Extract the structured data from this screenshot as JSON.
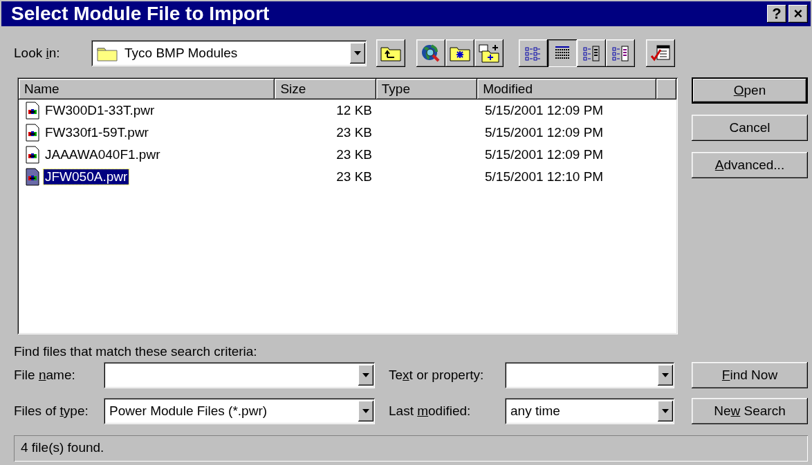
{
  "window": {
    "title": "Select Module File to Import",
    "help_button": "?",
    "close_button": "×"
  },
  "look_in": {
    "label": {
      "before": "Look ",
      "key": "i",
      "after": "n:"
    },
    "value": "Tyco BMP Modules"
  },
  "view_buttons": [
    {
      "selected": false
    },
    {
      "selected": true
    },
    {
      "selected": false
    },
    {
      "selected": false
    }
  ],
  "table": {
    "columns": [
      "Name",
      "Size",
      "Type",
      "Modified"
    ],
    "rows": [
      {
        "name": "FW300D1-33T.pwr",
        "size": "12 KB",
        "modified": "5/15/2001 12:09 PM",
        "selected": false
      },
      {
        "name": "FW330f1-59T.pwr",
        "size": "23 KB",
        "modified": "5/15/2001 12:09 PM",
        "selected": false
      },
      {
        "name": "JAAAWA040F1.pwr",
        "size": "23 KB",
        "modified": "5/15/2001 12:09 PM",
        "selected": false
      },
      {
        "name": "JFW050A.pwr",
        "size": "23 KB",
        "modified": "5/15/2001 12:10 PM",
        "selected": true
      }
    ]
  },
  "side_buttons": [
    {
      "label": {
        "key": "O",
        "after": "pen"
      },
      "default": true
    },
    {
      "label": {
        "before": "Cancel"
      },
      "default": false
    },
    {
      "label": {
        "key": "A",
        "after": "dvanced..."
      },
      "default": false
    }
  ],
  "search": {
    "heading": "Find files that match these search criteria:",
    "file_name": {
      "label": {
        "before": "File ",
        "key": "n",
        "after": "ame:"
      }
    },
    "text_or_property": {
      "label": {
        "before": "Te",
        "key": "x",
        "after": "t or property:"
      }
    },
    "files_of_type": {
      "label": {
        "before": "Files of ",
        "key": "t",
        "after": "ype:"
      },
      "value": "Power Module Files (*.pwr)"
    },
    "last_modified": {
      "label": {
        "before": "Last ",
        "key": "m",
        "after": "odified:"
      },
      "value": "any time"
    },
    "buttons": [
      {
        "label": {
          "key": "F",
          "after": "ind Now"
        }
      },
      {
        "label": {
          "before": "Ne",
          "key": "w",
          "after": " Search"
        }
      }
    ]
  },
  "status_bar": "4 file(s) found."
}
